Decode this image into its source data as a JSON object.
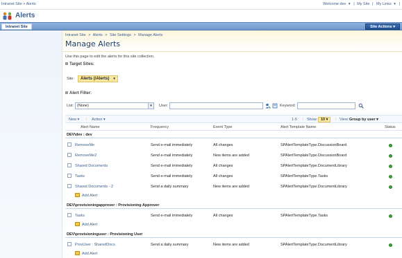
{
  "topbar": {
    "breadcrumb": "Intranet Site > Alerts",
    "welcome": "Welcome dev",
    "welcome_arrow": "▾",
    "my_site": "My Site",
    "my_links": "My Links",
    "my_links_arrow": "▾",
    "sep": "|"
  },
  "site": {
    "title": "Alerts"
  },
  "nav": {
    "tab": "Intranet Site",
    "site_actions": "Site Actions ▾"
  },
  "page": {
    "breadcrumb": [
      "Intranet Site",
      ">",
      "Alerts",
      ">",
      "Site Settings",
      ">",
      "Manage Alerts"
    ],
    "title": "Manage Alerts",
    "description": "Use this page to edit the alerts for this site collection."
  },
  "target": {
    "heading": "Target Sites:",
    "site_label": "Site:",
    "site_value": "Alerts (/Alerts)",
    "site_arrow": "▾"
  },
  "filter": {
    "heading": "Alert Filter:",
    "list_label": "List:",
    "list_value": "(None)",
    "user_label": "User:",
    "user_value": "",
    "keyword_label": "Keyword:",
    "keyword_value": ""
  },
  "toolbar": {
    "new": "New ▾",
    "action": "Action ▾",
    "range": "1-5",
    "show_label": "Show:",
    "show_value": "10 ▾",
    "view_label": "View:",
    "view_value": "Group by user ▾"
  },
  "grid": {
    "columns": [
      "Alert Name",
      "Frequency",
      "Event Type",
      "Alert Template Name",
      "Status"
    ],
    "add_alert": "Add Alert",
    "groups": [
      {
        "label": "DEV\\dev : dev",
        "rows": [
          {
            "name": "RemoveMe",
            "frequency": "Send e-mail immediately",
            "event": "All changes",
            "template": "SPAlertTemplateType.DiscussionBoard"
          },
          {
            "name": "RemoveMe2",
            "frequency": "Send e-mail immediately",
            "event": "New items are added",
            "template": "SPAlertTemplateType.DiscussionBoard"
          },
          {
            "name": "Shared Documents",
            "frequency": "Send e-mail immediately",
            "event": "All changes",
            "template": "SPAlertTemplateType.DocumentLibrary"
          },
          {
            "name": "Tasks",
            "frequency": "Send e-mail immediately",
            "event": "All changes",
            "template": "SPAlertTemplateType.Tasks"
          },
          {
            "name": "Shared Documents - 2",
            "frequency": "Send a daily summary",
            "event": "New items are added",
            "template": "SPAlertTemplateType.DocumentLibrary"
          }
        ]
      },
      {
        "label": "DEV\\provisioningapprover : Provisioning Approver",
        "rows": [
          {
            "name": "Tasks",
            "frequency": "Send e-mail immediately",
            "event": "All changes",
            "template": "SPAlertTemplateType.Tasks"
          }
        ]
      },
      {
        "label": "DEV\\provisioninguser : Provisioning User",
        "rows": [
          {
            "name": "ProvUser : SharedDocs",
            "frequency": "Send a daily summary",
            "event": "New items are added",
            "template": "SPAlertTemplateType.DocumentLibrary"
          }
        ]
      }
    ]
  }
}
